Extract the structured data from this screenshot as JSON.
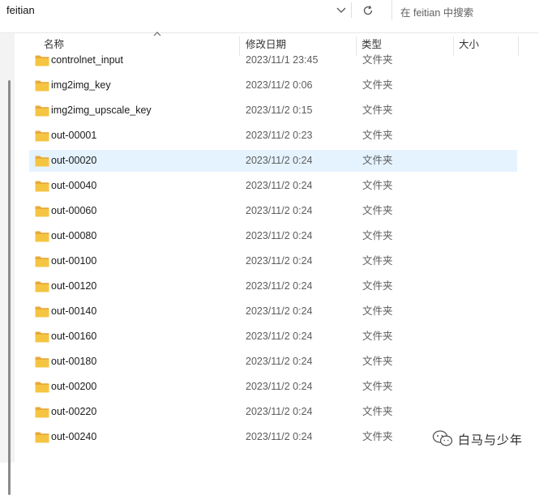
{
  "address": {
    "path": "feitian"
  },
  "search": {
    "placeholder": "在 feitian 中搜索"
  },
  "columns": {
    "name": "名称",
    "date": "修改日期",
    "type": "类型",
    "size": "大小"
  },
  "files": [
    {
      "name": "controlnet_input",
      "date": "2023/11/1 23:45",
      "type": "文件夹"
    },
    {
      "name": "img2img_key",
      "date": "2023/11/2 0:06",
      "type": "文件夹"
    },
    {
      "name": "img2img_upscale_key",
      "date": "2023/11/2 0:15",
      "type": "文件夹"
    },
    {
      "name": "out-00001",
      "date": "2023/11/2 0:23",
      "type": "文件夹"
    },
    {
      "name": "out-00020",
      "date": "2023/11/2 0:24",
      "type": "文件夹",
      "selected": true
    },
    {
      "name": "out-00040",
      "date": "2023/11/2 0:24",
      "type": "文件夹"
    },
    {
      "name": "out-00060",
      "date": "2023/11/2 0:24",
      "type": "文件夹"
    },
    {
      "name": "out-00080",
      "date": "2023/11/2 0:24",
      "type": "文件夹"
    },
    {
      "name": "out-00100",
      "date": "2023/11/2 0:24",
      "type": "文件夹"
    },
    {
      "name": "out-00120",
      "date": "2023/11/2 0:24",
      "type": "文件夹"
    },
    {
      "name": "out-00140",
      "date": "2023/11/2 0:24",
      "type": "文件夹"
    },
    {
      "name": "out-00160",
      "date": "2023/11/2 0:24",
      "type": "文件夹"
    },
    {
      "name": "out-00180",
      "date": "2023/11/2 0:24",
      "type": "文件夹"
    },
    {
      "name": "out-00200",
      "date": "2023/11/2 0:24",
      "type": "文件夹"
    },
    {
      "name": "out-00220",
      "date": "2023/11/2 0:24",
      "type": "文件夹"
    },
    {
      "name": "out-00240",
      "date": "2023/11/2 0:24",
      "type": "文件夹"
    }
  ],
  "watermark": {
    "text": "白马与少年"
  },
  "icons": {
    "chevron": "chevron-down-icon",
    "refresh": "refresh-icon",
    "folder": "folder-icon",
    "sort": "sort-up-icon",
    "wechat": "wechat-icon"
  },
  "colors": {
    "folder": "#f3c33b",
    "selected_row": "#e5f3ff"
  }
}
